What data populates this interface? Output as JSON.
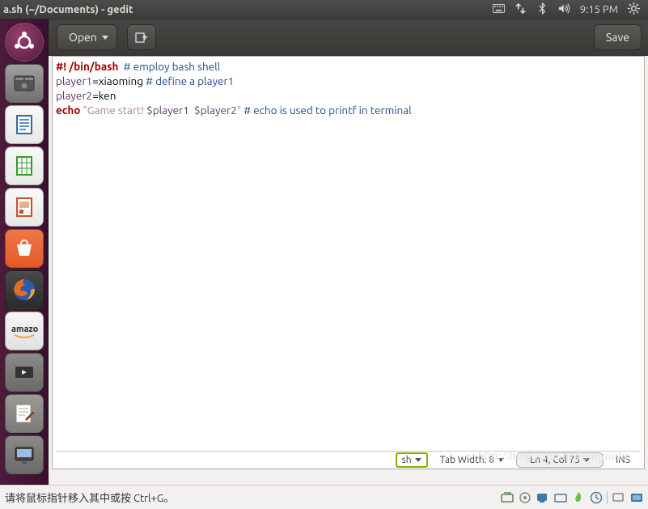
{
  "top_panel": {
    "title": "a.sh (~/Documents) - gedit",
    "time": "9:15 PM"
  },
  "toolbar": {
    "open_label": "Open",
    "save_label": "Save"
  },
  "code": {
    "l1_shebang": "#! /bin/bash",
    "l1_comment": "  # employ bash shell",
    "l2_var": "player1",
    "l2_eq": "=",
    "l2_val": "xiaoming ",
    "l2_comment": "# define a player1",
    "l3_var": "player2",
    "l3_eq": "=",
    "l3_val": "ken",
    "l4_kw": "echo",
    "l4_sp1": " ",
    "l4_q1": "\"",
    "l4_str_a": "Game start! ",
    "l4_var1": "$player1",
    "l4_str_b": "  ",
    "l4_var2": "$player2",
    "l4_q2": "\"",
    "l4_sp2": " ",
    "l4_comment": "# echo is used to printf in terminal"
  },
  "watermark": "http://blog.csdn.net/daigualu",
  "statusbar": {
    "lang": "sh",
    "tab_width": "Tab Width: 8",
    "position": "Ln 4, Col 75",
    "mode": "INS"
  },
  "bottom_bar": {
    "message": "请将鼠标指针移入其中或按 Ctrl+G。"
  },
  "launcher": {
    "items": [
      "dash",
      "files",
      "writer",
      "calc",
      "impress",
      "software",
      "firefox",
      "amazon",
      "movie",
      "gedit",
      "screenshot"
    ]
  }
}
